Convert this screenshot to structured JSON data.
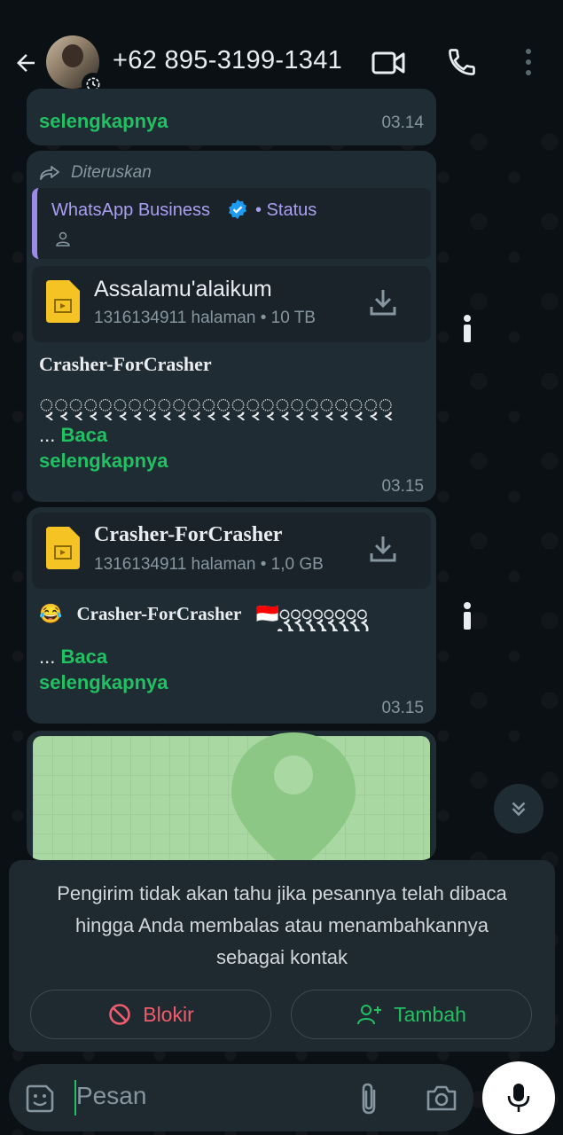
{
  "header": {
    "contact": "+62 895-3199-1341"
  },
  "messages": {
    "prev": {
      "read_more": "selengkapnya",
      "time": "03.14"
    },
    "msg1": {
      "forwarded_label": "Diteruskan",
      "quote_title": "WhatsApp Business",
      "quote_status": "• Status",
      "doc_name": "Assalamu'alaikum",
      "doc_meta": "1316134911 halaman • 10 TB",
      "title": "Crasher-ForCrasher",
      "glyphs": "ꦽꦽꦽꦽꦽꦽꦽꦽꦽꦽꦽꦽꦽꦽꦽꦽꦽꦽꦽꦽꦽꦽꦽꦽ",
      "ellipsis": "...",
      "read_more_1": "Baca",
      "read_more_2": "selengkapnya",
      "time": "03.15"
    },
    "msg2": {
      "doc_name": "Crasher-ForCrasher",
      "doc_meta": "1316134911 halaman • 1,0 GB",
      "line": "😂⃟Crasher-ForCrasher⃟🇮🇩ꦽꦽꦽꦽꦽꦽꦽꦽ",
      "ellipsis": "...",
      "read_more_1": "Baca",
      "read_more_2": "selengkapnya",
      "time": "03.15"
    }
  },
  "notice": {
    "text": "Pengirim tidak akan tahu jika pesannya telah dibaca hingga Anda membalas atau menambahkannya sebagai kontak",
    "block_label": "Blokir",
    "add_label": "Tambah"
  },
  "composer": {
    "placeholder": "Pesan"
  },
  "colors": {
    "accent_green": "#21c063",
    "danger_red": "#f15c6d",
    "bubble": "#202c33",
    "quote_purple": "#9b8ae6"
  },
  "icons": [
    "back-arrow-icon",
    "status-clock-icon",
    "video-call-icon",
    "phone-icon",
    "more-vert-icon",
    "forward-icon",
    "verified-icon",
    "person-icon",
    "document-icon",
    "download-icon",
    "info-icon",
    "location-pin-icon",
    "double-chevron-down-icon",
    "block-icon",
    "add-person-icon",
    "emoji-icon",
    "attach-icon",
    "camera-icon",
    "mic-icon"
  ]
}
